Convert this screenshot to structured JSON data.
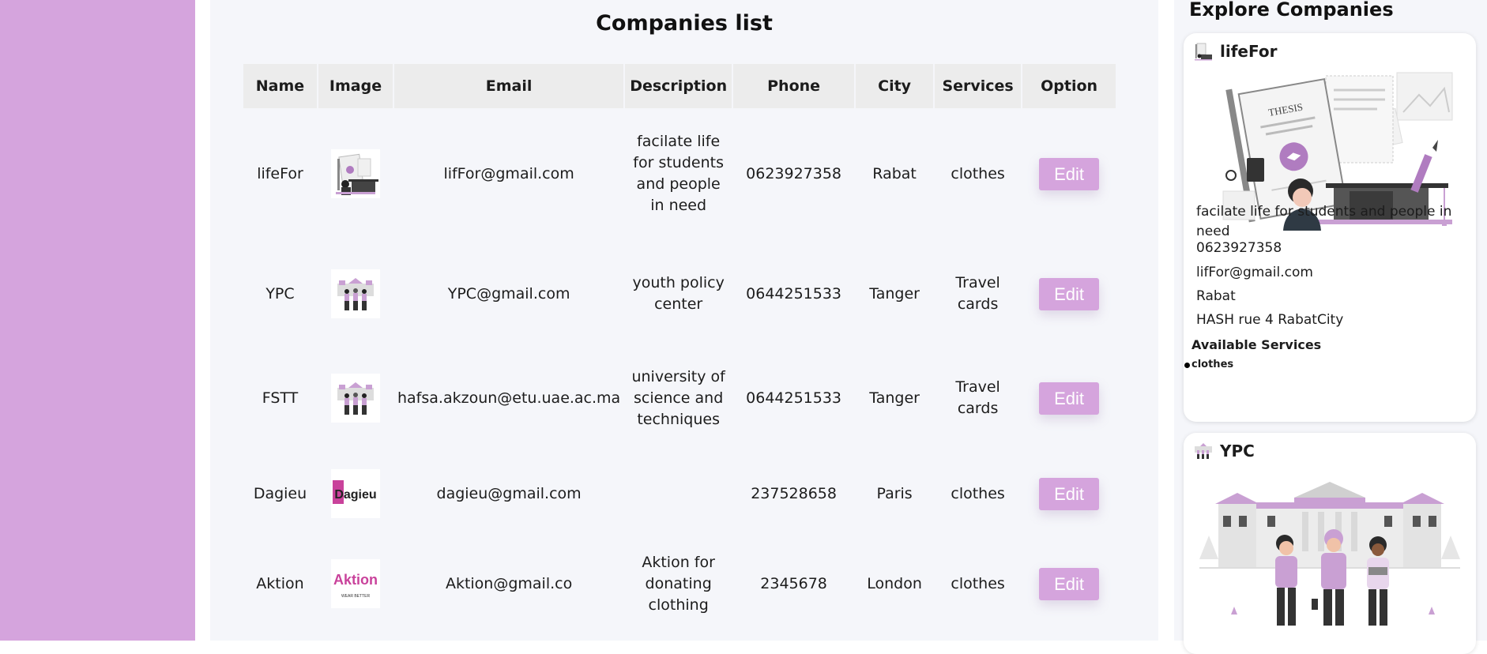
{
  "main": {
    "title": "Companies list",
    "columns": [
      "Name",
      "Image",
      "Email",
      "Description",
      "Phone",
      "City",
      "Services",
      "Option"
    ],
    "edit_label": "Edit",
    "rows": [
      {
        "name": "lifeFor",
        "email": "lifFor@gmail.com",
        "description": "facilate life for students and people in need",
        "phone": "0623927358",
        "city": "Rabat",
        "services": "clothes"
      },
      {
        "name": "YPC",
        "email": "YPC@gmail.com",
        "description": "youth policy center",
        "phone": "0644251533",
        "city": "Tanger",
        "services": "Travel cards"
      },
      {
        "name": "FSTT",
        "email": "hafsa.akzoun@etu.uae.ac.ma",
        "description": "university of science and techniques",
        "phone": "0644251533",
        "city": "Tanger",
        "services": "Travel cards"
      },
      {
        "name": "Dagieu",
        "email": "dagieu@gmail.com",
        "description": "",
        "phone": "237528658",
        "city": "Paris",
        "services": "clothes"
      },
      {
        "name": "Aktion",
        "email": "Aktion@gmail.co",
        "description": "Aktion for donating clothing",
        "phone": "2345678",
        "city": "London",
        "services": "clothes"
      }
    ],
    "logo_texts": {
      "dagieu": "Dagieu",
      "aktion": "Aktion",
      "aktion_tag": "WEAR BETTER",
      "thesis": "THESIS"
    }
  },
  "explore": {
    "title": "Explore Companies",
    "cards": [
      {
        "name": "lifeFor",
        "description": "facilate life for students and people in need",
        "phone": "0623927358",
        "email": "lifFor@gmail.com",
        "city": "Rabat",
        "address": "HASH rue 4 RabatCity",
        "services_title": "Available Services",
        "services": [
          "clothes"
        ]
      },
      {
        "name": "YPC"
      }
    ]
  },
  "colors": {
    "sidebar": "#d5a4dd",
    "accent": "#d5a4dd",
    "background": "#f5f6fa"
  }
}
